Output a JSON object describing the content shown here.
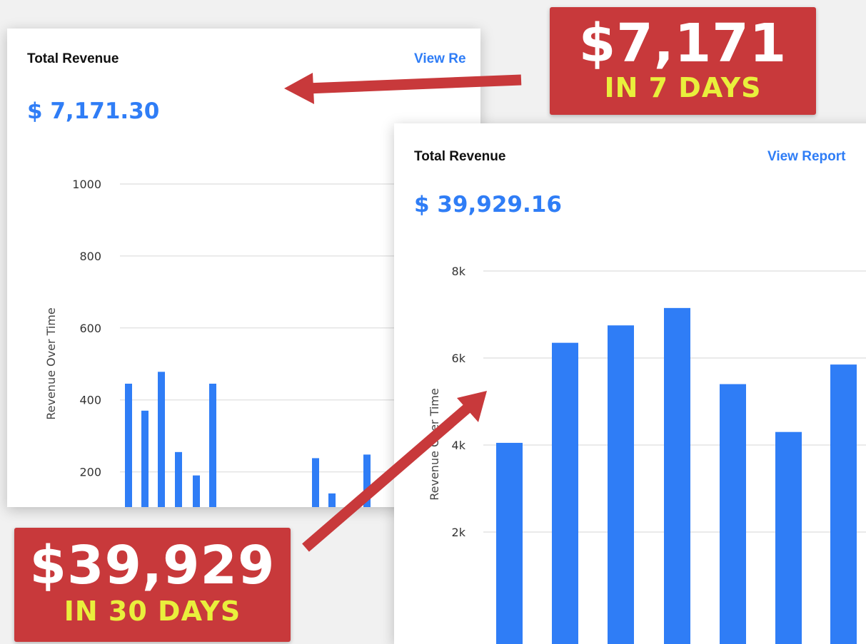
{
  "colors": {
    "accent": "#2f7df6",
    "bar": "#2f7df6",
    "badge_bg": "#c8393b",
    "badge_highlight": "#e9ef3c",
    "arrow": "#c8393b"
  },
  "left_card": {
    "title": "Total Revenue",
    "view_link": "View Re",
    "total": "$ 7,171.30"
  },
  "right_card": {
    "title": "Total Revenue",
    "view_link": "View Report",
    "total": "$ 39,929.16"
  },
  "badges": {
    "top": {
      "amount": "$7,171",
      "period": "IN 7 DAYS"
    },
    "bottom": {
      "amount": "$39,929",
      "period": "IN 30 DAYS"
    }
  },
  "chart_data": [
    {
      "type": "bar",
      "ylabel": "Revenue Over Time",
      "y_ticks": [
        "200",
        "400",
        "600",
        "800",
        "1000"
      ],
      "y_tick_values": [
        200,
        400,
        600,
        800,
        1000
      ],
      "ylim": [
        110,
        1000
      ],
      "grid": true,
      "values": [
        445,
        370,
        478,
        255,
        190,
        445,
        238,
        140,
        248
      ]
    },
    {
      "type": "bar",
      "ylabel": "Revenue Over Time",
      "y_ticks": [
        "2k",
        "4k",
        "6k",
        "8k"
      ],
      "y_tick_values": [
        2000,
        4000,
        6000,
        8000
      ],
      "ylim": [
        0,
        8000
      ],
      "grid": true,
      "values": [
        4050,
        6350,
        6750,
        7150,
        5400,
        4300,
        5850
      ]
    }
  ]
}
